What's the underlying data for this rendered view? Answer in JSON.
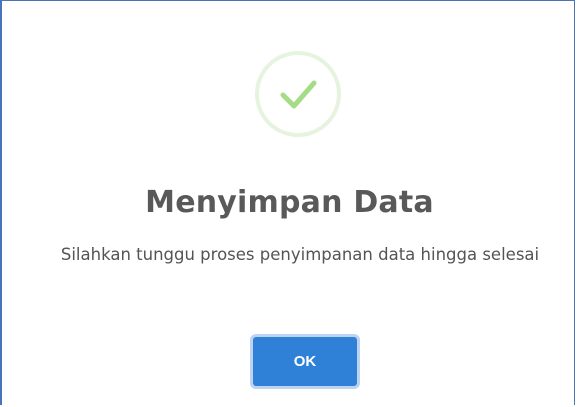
{
  "dialog": {
    "icon": "check-circle-icon",
    "title": "Menyimpan Data",
    "message": "Silahkan tunggu proses penyimpanan data hingga selesai",
    "ok_label": "OK"
  },
  "colors": {
    "border": "#4a73b8",
    "success": "#a5dc86",
    "success_ring": "#e6f3df",
    "button": "#2f80d7",
    "title_text": "#595959"
  }
}
